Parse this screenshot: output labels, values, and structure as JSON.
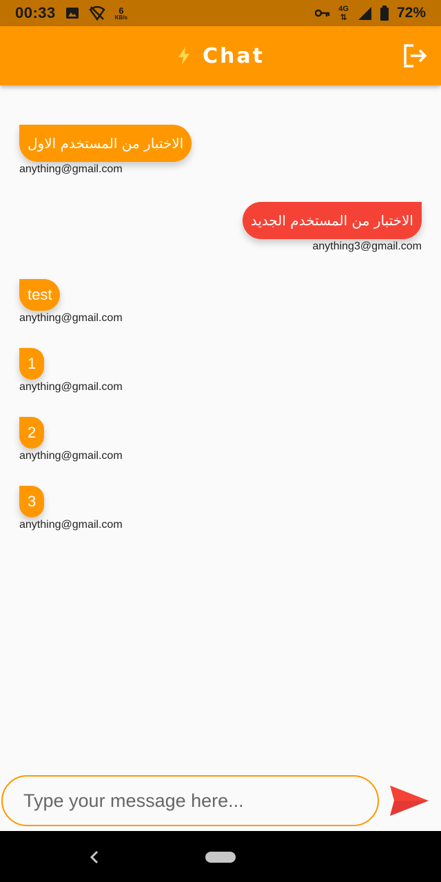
{
  "status_bar": {
    "time": "00:33",
    "net_speed_value": "6",
    "net_speed_unit": "KB/s",
    "network_type": "4G",
    "battery": "72%",
    "icons": [
      "image-icon",
      "no-signal-wifi-icon",
      "vpn-key-icon",
      "signal-icon",
      "battery-icon"
    ]
  },
  "app_bar": {
    "title": "Chat",
    "icons": [
      "bolt-icon",
      "logout-icon"
    ]
  },
  "messages": [
    {
      "side": "received",
      "text": "الاختبار من المستخدم الاول",
      "sender": "anything@gmail.com",
      "rtl": true
    },
    {
      "side": "sent",
      "text": "الاختبار من المستخدم الجديد",
      "sender": "anything3@gmail.com",
      "rtl": true
    },
    {
      "side": "received",
      "text": "test",
      "sender": "anything@gmail.com",
      "rtl": false
    },
    {
      "side": "received",
      "text": "1",
      "sender": "anything@gmail.com",
      "rtl": false
    },
    {
      "side": "received",
      "text": "2",
      "sender": "anything@gmail.com",
      "rtl": false
    },
    {
      "side": "received",
      "text": "3",
      "sender": "anything@gmail.com",
      "rtl": false
    }
  ],
  "input": {
    "placeholder": "Type your message here...",
    "value": ""
  },
  "colors": {
    "status_bar": "#c07200",
    "accent": "#ff9800",
    "sent_bubble": "#f44336",
    "send_icon": "#f44336",
    "background": "#fafafa"
  }
}
